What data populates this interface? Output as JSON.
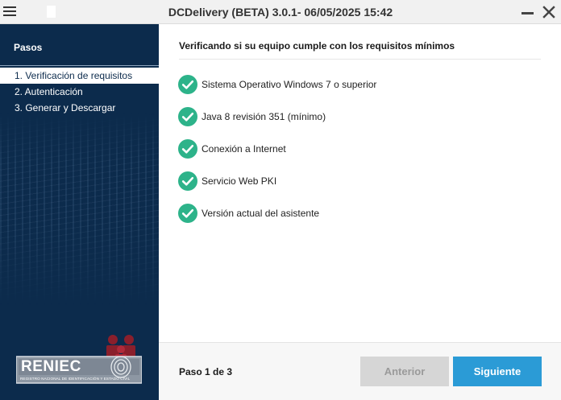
{
  "window": {
    "title": "DCDelivery (BETA) 3.0.1- 06/05/2025 15:42",
    "icons": {
      "menu": "hamburger-menu-icon",
      "minimize": "minimize-icon",
      "close": "close-icon"
    }
  },
  "sidebar": {
    "heading": "Pasos",
    "steps": [
      {
        "label": "1. Verificación de requisitos",
        "active": true
      },
      {
        "label": "2. Autenticación",
        "active": false
      },
      {
        "label": "3. Generar y Descargar",
        "active": false
      }
    ],
    "logo": {
      "name": "RENIEC",
      "subtitle": "REGISTRO NACIONAL DE IDENTIFICACIÓN Y ESTADO CIVIL"
    }
  },
  "main": {
    "title": "Verificando si su equipo cumple con los requisitos mínimos",
    "requirements": [
      {
        "label": "Sistema Operativo Windows 7 o superior",
        "status": "ok"
      },
      {
        "label": "Java 8 revisión 351 (mínimo)",
        "status": "ok"
      },
      {
        "label": "Conexión a Internet",
        "status": "ok"
      },
      {
        "label": "Servicio Web PKI",
        "status": "ok"
      },
      {
        "label": "Versión actual del asistente",
        "status": "ok"
      }
    ]
  },
  "footer": {
    "step_counter": "Paso 1 de 3",
    "prev_label": "Anterior",
    "next_label": "Siguiente",
    "prev_enabled": false
  },
  "colors": {
    "sidebar_bg": "#0c2b4c",
    "check_green": "#2db38a",
    "primary_button": "#2b9bd6",
    "disabled_button": "#d6d6d6"
  }
}
